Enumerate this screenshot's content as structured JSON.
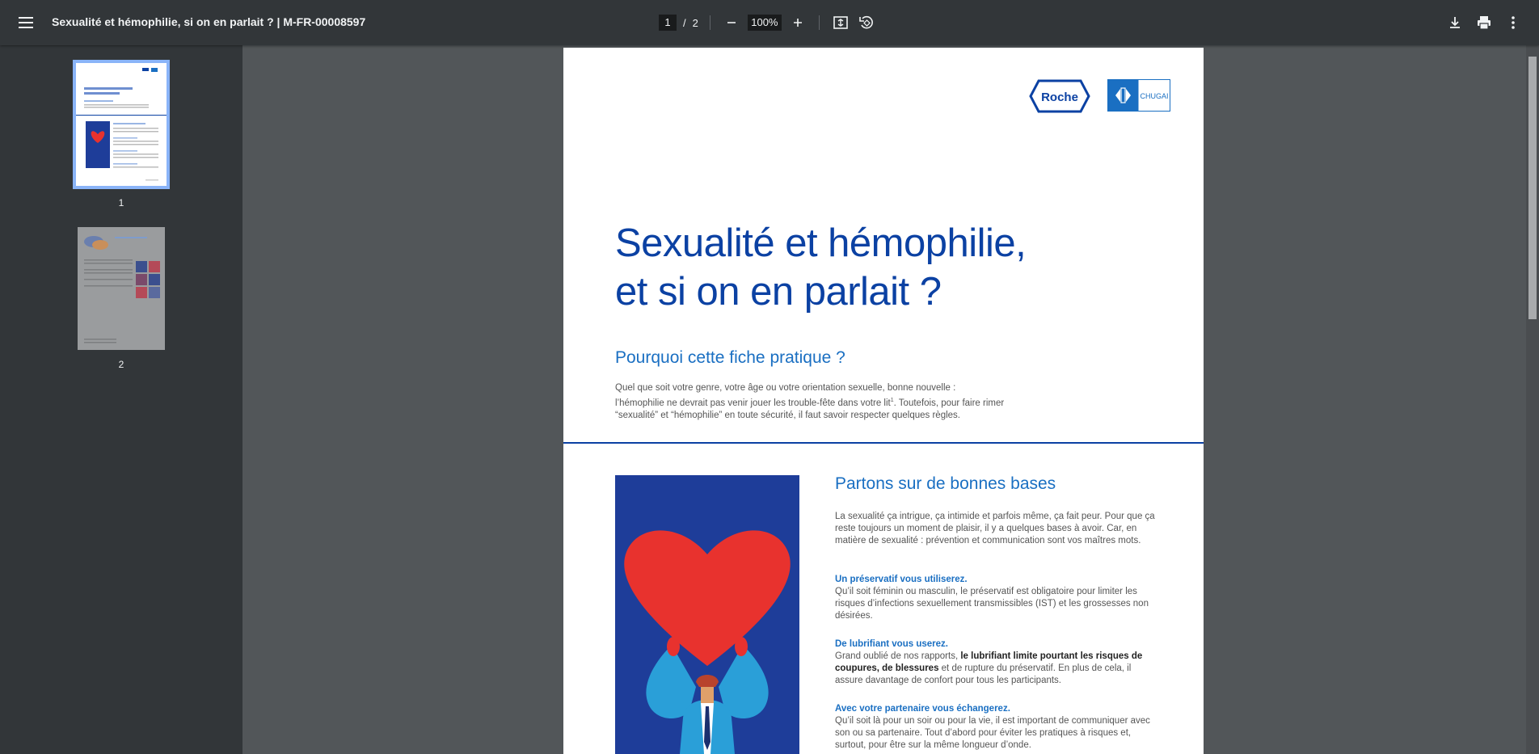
{
  "viewer": {
    "title": "Sexualité et hémophilie, si on en parlait ? | M-FR-00008597",
    "current_page": "1",
    "page_separator": "/",
    "total_pages": "2",
    "zoom": "100%"
  },
  "thumbnails": [
    {
      "label": "1",
      "selected": true
    },
    {
      "label": "2",
      "selected": false
    }
  ],
  "document": {
    "logos": {
      "roche": "Roche",
      "chugai": "CHUGAI"
    },
    "title_line1": "Sexualité et hémophilie,",
    "title_line2": "et si on en parlait ?",
    "intro_heading": "Pourquoi cette fiche pratique ?",
    "intro_line1": "Quel que soit votre genre, votre âge ou votre orientation sexuelle, bonne nouvelle :",
    "intro_line2a": "l’hémophilie ne devrait pas venir jouer les trouble-fête dans votre lit",
    "intro_sup": "1",
    "intro_line2b": ". Toutefois, pour faire rimer",
    "intro_line3": "“sexualité” et “hémophilie” en toute sécurité, il faut savoir respecter quelques règles.",
    "section_heading": "Partons sur de bonnes bases",
    "section_p1": "La sexualité ça intrigue, ça intimide et parfois même, ça fait peur. Pour que ça reste toujours un moment de plaisir, il y a quelques bases à avoir. Car, en matière de sexualité : prévention et communication sont vos maîtres mots.",
    "sub1": "Un préservatif vous utiliserez.",
    "sub1_text": "Qu’il soit féminin ou masculin, le préservatif est obligatoire pour limiter les risques d’infections sexuellement transmissibles (IST) et les grossesses non désirées.",
    "sub2": "De lubrifiant vous userez.",
    "sub2_text_a": "Grand oublié de nos rapports, ",
    "sub2_text_bold": "le lubrifiant limite pourtant les risques de coupures, de blessures",
    "sub2_text_b": " et de rupture du préservatif. En plus de cela, il assure davantage de confort pour tous les participants.",
    "sub3": "Avec votre partenaire vous échangerez.",
    "sub3_text": "Qu’il soit là pour un soir ou pour la vie, il est important de communiquer avec son ou sa partenaire. Tout d’abord pour éviter les pratiques à risques et, surtout, pour être sur la même longueur d’onde."
  },
  "icons": [
    "menu-icon",
    "zoom-out-icon",
    "zoom-in-icon",
    "fit-page-icon",
    "rotate-icon",
    "download-icon",
    "print-icon",
    "more-vert-icon"
  ]
}
